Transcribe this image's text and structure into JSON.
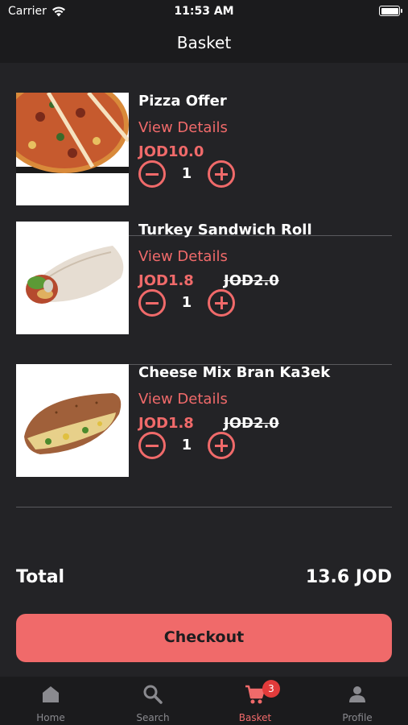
{
  "status_bar": {
    "carrier": "Carrier",
    "time": "11:53 AM"
  },
  "nav": {
    "title": "Basket"
  },
  "items": [
    {
      "name": "Pizza Offer",
      "details_label": "View Details",
      "price": "JOD10.0",
      "old_price": "",
      "quantity": "1",
      "image": "pizza"
    },
    {
      "name": "Turkey Sandwich Roll",
      "details_label": "View Details",
      "price": "JOD1.8",
      "old_price": "JOD2.0",
      "quantity": "1",
      "image": "wrap"
    },
    {
      "name": "Cheese Mix Bran Ka3ek",
      "details_label": "View Details",
      "price": "JOD1.8",
      "old_price": "JOD2.0",
      "quantity": "1",
      "image": "sandwich"
    }
  ],
  "total": {
    "label": "Total",
    "value": "13.6 JOD"
  },
  "checkout": {
    "label": "Checkout"
  },
  "tabs": [
    {
      "label": "Home",
      "icon": "home-icon"
    },
    {
      "label": "Search",
      "icon": "search-icon"
    },
    {
      "label": "Basket",
      "icon": "cart-icon",
      "badge": "3"
    },
    {
      "label": "Profile",
      "icon": "person-icon"
    }
  ],
  "colors": {
    "accent": "#f06a6a",
    "background": "#232326",
    "bar": "#1b1b1d",
    "badge": "#e23b3b",
    "inactive": "#8a8a8f"
  }
}
